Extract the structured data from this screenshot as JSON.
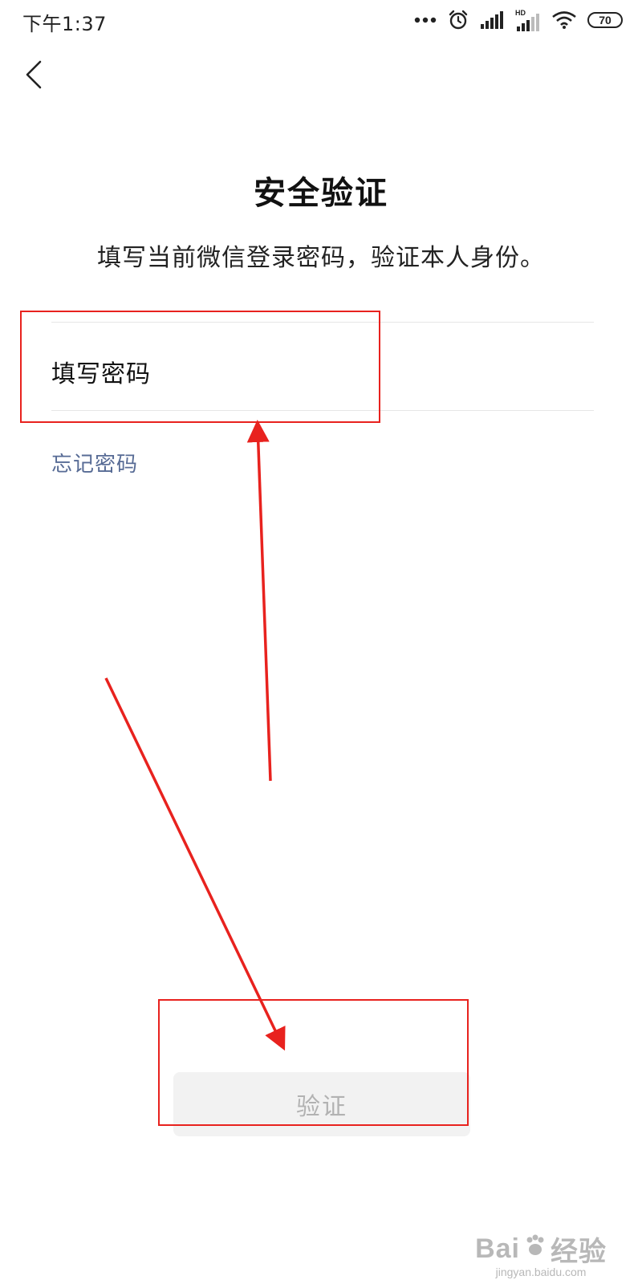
{
  "status_bar": {
    "time": "下午1:37",
    "battery": "70",
    "icons": [
      "more-dots-icon",
      "alarm-icon",
      "signal-icon",
      "hd-signal-icon",
      "wifi-icon",
      "battery-icon"
    ]
  },
  "header": {
    "back_icon": "chevron-left-icon"
  },
  "main": {
    "title": "安全验证",
    "subtitle": "填写当前微信登录密码，验证本人身份。",
    "password_placeholder": "填写密码",
    "forgot_password": "忘记密码",
    "verify_button": "验证"
  },
  "colors": {
    "link": "#576b95",
    "button_bg": "#f2f2f2",
    "button_text": "#b2b2b2",
    "annotation": "#e8221e"
  },
  "watermark": {
    "logo_text": "Bai",
    "logo_suffix": "经验",
    "url": "jingyan.baidu.com"
  }
}
